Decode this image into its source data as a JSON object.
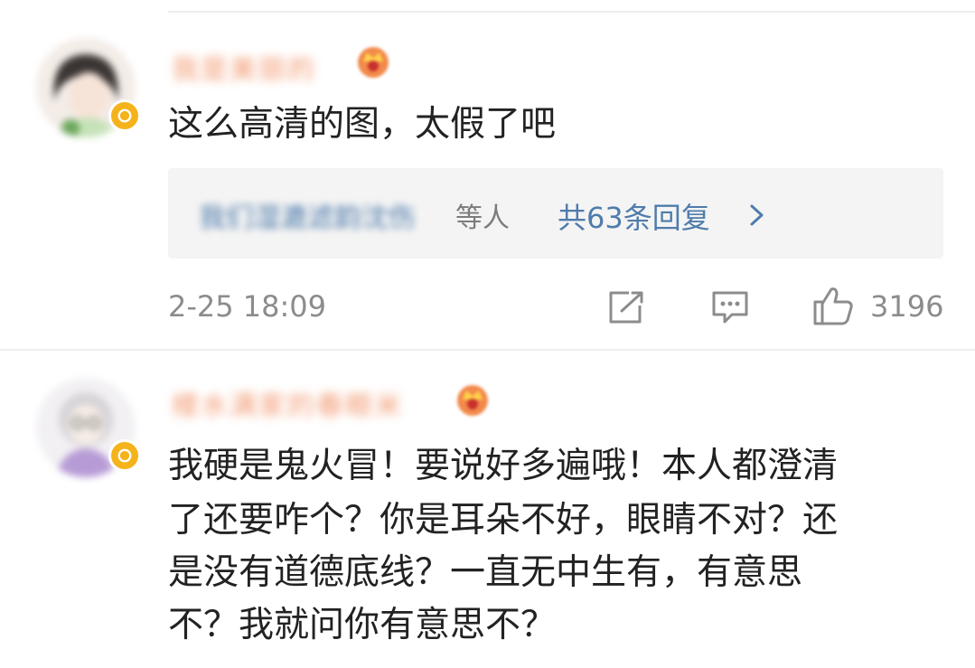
{
  "comments": [
    {
      "username": "我是美丽的",
      "text": "这么高清的图，太假了吧",
      "reply_preview": {
        "names_blurred": "我们湿漉滤韵沈伤",
        "names_suffix": "等人",
        "count_label": "共63条回复"
      },
      "timestamp": "2-25 18:09",
      "likes": "3196"
    },
    {
      "username": "楼水满家的春眼米",
      "text_lines": [
        "我硬是鬼火冒！要说好多遍哦！本人都澄清",
        "了还要咋个？你是耳朵不好，眼睛不对？还",
        "是没有道德底线？一直无中生有，有意思",
        "不？我就问你有意思不？"
      ]
    }
  ],
  "colors": {
    "username": "#f39a72",
    "link_blue": "#4f7cab",
    "meta_gray": "#8c8c8c",
    "badge_gold": "#f5b31b"
  },
  "icons": [
    "verified-icon",
    "crown-icon",
    "chevron-right-icon",
    "share-icon",
    "comment-icon",
    "thumbs-up-icon"
  ]
}
